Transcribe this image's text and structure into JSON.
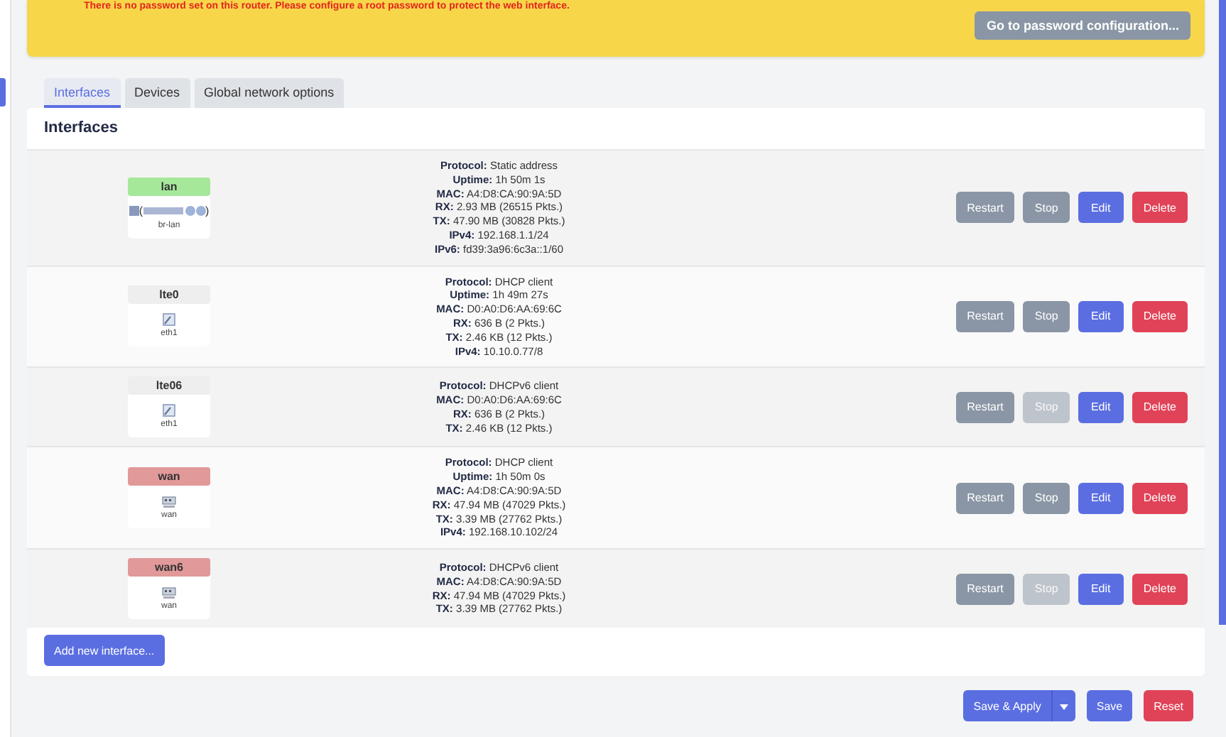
{
  "banner": {
    "message": "There is no password set on this router. Please configure a root password to protect the web interface.",
    "button": "Go to password configuration..."
  },
  "tabs": [
    {
      "label": "Interfaces",
      "selected": true
    },
    {
      "label": "Devices",
      "selected": false
    },
    {
      "label": "Global network options",
      "selected": false
    }
  ],
  "panel": {
    "title": "Interfaces",
    "add_button": "Add new interface..."
  },
  "rows": [
    {
      "name": "lan",
      "color": "#a6e89a",
      "kind": "bridge",
      "ports_open": "(",
      "ports_close": ")",
      "device": "br-lan",
      "details": [
        {
          "label": "Protocol:",
          "value": "Static address"
        },
        {
          "label": "Uptime:",
          "value": "1h 50m 1s"
        },
        {
          "label": "MAC:",
          "value": "A4:D8:CA:90:9A:5D"
        },
        {
          "label": "RX:",
          "value": "2.93 MB (26515 Pkts.)"
        },
        {
          "label": "TX:",
          "value": "47.90 MB (30828 Pkts.)"
        },
        {
          "label": "IPv4:",
          "value": "192.168.1.1/24"
        },
        {
          "label": "IPv6:",
          "value": "fd39:3a96:6c3a::1/60"
        }
      ],
      "buttons": [
        {
          "label": "Restart",
          "kind": "neutral",
          "disabled": false
        },
        {
          "label": "Stop",
          "kind": "neutral",
          "disabled": false
        },
        {
          "label": "Edit",
          "kind": "primary",
          "disabled": false
        },
        {
          "label": "Delete",
          "kind": "danger",
          "disabled": false
        }
      ]
    },
    {
      "name": "lte0",
      "color": "#eeeeee",
      "kind": "ethernet",
      "device": "eth1",
      "details": [
        {
          "label": "Protocol:",
          "value": "DHCP client"
        },
        {
          "label": "Uptime:",
          "value": "1h 49m 27s"
        },
        {
          "label": "MAC:",
          "value": "D0:A0:D6:AA:69:6C"
        },
        {
          "label": "RX:",
          "value": "636 B (2 Pkts.)"
        },
        {
          "label": "TX:",
          "value": "2.46 KB (12 Pkts.)"
        },
        {
          "label": "IPv4:",
          "value": "10.10.0.77/8"
        }
      ],
      "buttons": [
        {
          "label": "Restart",
          "kind": "neutral",
          "disabled": false
        },
        {
          "label": "Stop",
          "kind": "neutral",
          "disabled": false
        },
        {
          "label": "Edit",
          "kind": "primary",
          "disabled": false
        },
        {
          "label": "Delete",
          "kind": "danger",
          "disabled": false
        }
      ]
    },
    {
      "name": "lte06",
      "color": "#eeeeee",
      "kind": "ethernet",
      "device": "eth1",
      "details": [
        {
          "label": "Protocol:",
          "value": "DHCPv6 client"
        },
        {
          "label": "MAC:",
          "value": "D0:A0:D6:AA:69:6C"
        },
        {
          "label": "RX:",
          "value": "636 B (2 Pkts.)"
        },
        {
          "label": "TX:",
          "value": "2.46 KB (12 Pkts.)"
        }
      ],
      "buttons": [
        {
          "label": "Restart",
          "kind": "neutral",
          "disabled": false
        },
        {
          "label": "Stop",
          "kind": "neutral",
          "disabled": true
        },
        {
          "label": "Edit",
          "kind": "primary",
          "disabled": false
        },
        {
          "label": "Delete",
          "kind": "danger",
          "disabled": false
        }
      ]
    },
    {
      "name": "wan",
      "color": "#e19999",
      "kind": "switch",
      "device": "wan",
      "details": [
        {
          "label": "Protocol:",
          "value": "DHCP client"
        },
        {
          "label": "Uptime:",
          "value": "1h 50m 0s"
        },
        {
          "label": "MAC:",
          "value": "A4:D8:CA:90:9A:5D"
        },
        {
          "label": "RX:",
          "value": "47.94 MB (47029 Pkts.)"
        },
        {
          "label": "TX:",
          "value": "3.39 MB (27762 Pkts.)"
        },
        {
          "label": "IPv4:",
          "value": "192.168.10.102/24"
        }
      ],
      "buttons": [
        {
          "label": "Restart",
          "kind": "neutral",
          "disabled": false
        },
        {
          "label": "Stop",
          "kind": "neutral",
          "disabled": false
        },
        {
          "label": "Edit",
          "kind": "primary",
          "disabled": false
        },
        {
          "label": "Delete",
          "kind": "danger",
          "disabled": false
        }
      ]
    },
    {
      "name": "wan6",
      "color": "#e19999",
      "kind": "switch",
      "device": "wan",
      "details": [
        {
          "label": "Protocol:",
          "value": "DHCPv6 client"
        },
        {
          "label": "MAC:",
          "value": "A4:D8:CA:90:9A:5D"
        },
        {
          "label": "RX:",
          "value": "47.94 MB (47029 Pkts.)"
        },
        {
          "label": "TX:",
          "value": "3.39 MB (27762 Pkts.)"
        }
      ],
      "buttons": [
        {
          "label": "Restart",
          "kind": "neutral",
          "disabled": false
        },
        {
          "label": "Stop",
          "kind": "neutral",
          "disabled": true
        },
        {
          "label": "Edit",
          "kind": "primary",
          "disabled": false
        },
        {
          "label": "Delete",
          "kind": "danger",
          "disabled": false
        }
      ]
    }
  ],
  "footer": {
    "save_apply": "Save & Apply",
    "save": "Save",
    "reset": "Reset"
  }
}
